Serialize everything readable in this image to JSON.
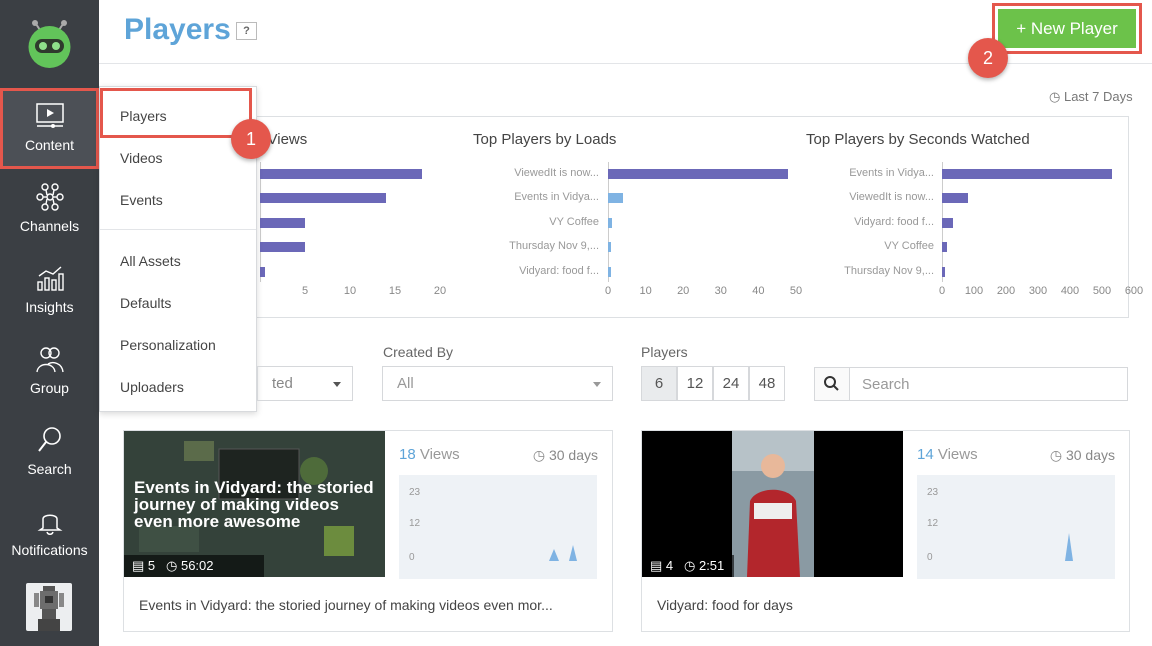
{
  "sidebar": {
    "items": [
      {
        "label": "Content",
        "icon": "play-screen-icon",
        "active": true
      },
      {
        "label": "Channels",
        "icon": "channels-network-icon"
      },
      {
        "label": "Insights",
        "icon": "bar-chart-icon"
      },
      {
        "label": "Group",
        "icon": "group-people-icon"
      },
      {
        "label": "Search",
        "icon": "magnifier-icon"
      },
      {
        "label": "Notifications",
        "icon": "bell-icon"
      }
    ]
  },
  "header": {
    "title": "Players",
    "help": "?",
    "new_player": "+ New Player"
  },
  "annotations": {
    "one": "1",
    "two": "2"
  },
  "range_label": "Last 7 Days",
  "content_menu": {
    "items": [
      "Players",
      "Videos",
      "Events",
      "All Assets",
      "Defaults",
      "Personalization",
      "Uploaders"
    ]
  },
  "charts": [
    {
      "title": "o Views",
      "labels": [],
      "values": [
        18,
        14,
        5,
        5,
        0.5
      ],
      "ticks": [
        "5",
        "10",
        "15",
        "20"
      ],
      "max": 20
    },
    {
      "title": "Top Players by Loads",
      "labels": [
        "ViewedIt is now...",
        "Events in Vidya...",
        "VY Coffee",
        "Thursday Nov 9,...",
        "Vidyard: food f..."
      ],
      "values": [
        48,
        4,
        1,
        0.5,
        0.5
      ],
      "ticks": [
        "0",
        "10",
        "20",
        "30",
        "40",
        "50"
      ],
      "max": 50
    },
    {
      "title": "Top Players by Seconds Watched",
      "labels": [
        "Events in Vidya...",
        "ViewedIt is now...",
        "Vidyard: food f...",
        "VY Coffee",
        "Thursday Nov 9,..."
      ],
      "values": [
        530,
        80,
        35,
        15,
        3
      ],
      "ticks": [
        "0",
        "100",
        "200",
        "300",
        "400",
        "500",
        "600"
      ],
      "max": 600
    }
  ],
  "filters": {
    "status_value": "ted",
    "created_by_label": "Created By",
    "created_by_value": "All",
    "players_label": "Players",
    "page_sizes": [
      "6",
      "12",
      "24",
      "48"
    ],
    "search_placeholder": "Search"
  },
  "cards": [
    {
      "thumb_caption": "Events in Vidyard: the storied journey of making videos even more awesome",
      "videos": "5",
      "duration": "56:02",
      "views_num": "18",
      "views_word": "Views",
      "days": "30 days",
      "y_ticks": [
        "23",
        "12",
        "0"
      ],
      "title": "Events in Vidyard: the storied journey of making videos even mor..."
    },
    {
      "thumb_caption": "",
      "videos": "4",
      "duration": "2:51",
      "views_num": "14",
      "views_word": "Views",
      "days": "30 days",
      "y_ticks": [
        "23",
        "12",
        "0"
      ],
      "title": "Vidyard: food for days"
    }
  ],
  "colors": {
    "accent": "#5ea4d8",
    "bar_primary": "#6b68b8",
    "bar_light": "#7fb3e3",
    "green": "#6cc24a",
    "highlight": "#e4574c",
    "sidebar": "#3b3f44"
  }
}
